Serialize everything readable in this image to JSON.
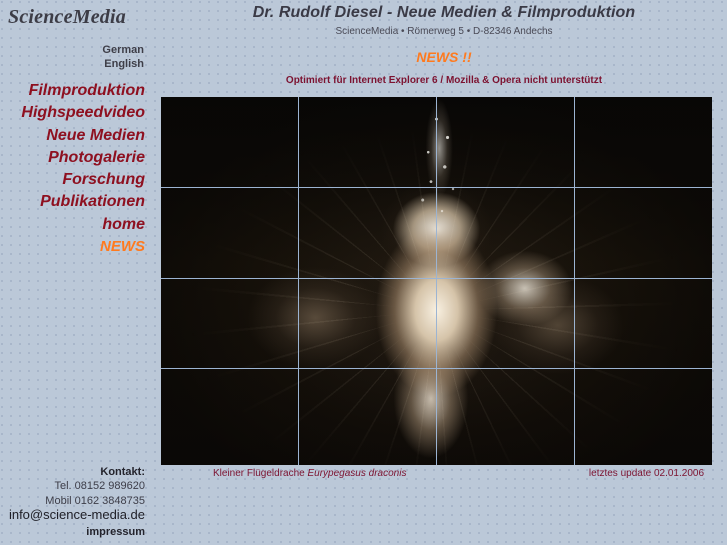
{
  "brand": {
    "logo": "ScienceMedia"
  },
  "language_nav": {
    "items": [
      {
        "label": "German"
      },
      {
        "label": "English"
      }
    ]
  },
  "main_nav": {
    "items": [
      {
        "label": "Filmproduktion"
      },
      {
        "label": "Highspeedvideo"
      },
      {
        "label": "Neue Medien"
      },
      {
        "label": "Photogalerie"
      },
      {
        "label": "Forschung"
      },
      {
        "label": "Publikationen"
      },
      {
        "label": "home"
      },
      {
        "label": "NEWS"
      }
    ],
    "link_color": "#8e1020",
    "news_color": "#ff7a1e"
  },
  "contact": {
    "heading": "Kontakt:",
    "phone": "Tel. 08152 989620",
    "mobile": "Mobil 0162 3848735",
    "email": "info@science-media.de",
    "impressum": "impressum"
  },
  "header": {
    "title": "Dr. Rudolf Diesel  -  Neue Medien & Filmproduktion",
    "subtitle": "ScienceMedia • Römerweg 5 • D-82346 Andechs",
    "news_banner": "NEWS !!",
    "browser_notice": "Optimiert für Internet Explorer 6 / Mozilla & Opera nicht unterstützt",
    "news_color": "#ff7a1e",
    "notice_color": "#7c1230"
  },
  "feature_image": {
    "alt": "Kleiner Flügeldrache Eurypegasus draconis underwater photograph",
    "grid_line_color": "#9cb4d2"
  },
  "caption": {
    "common_name": "Kleiner Flügeldrache ",
    "species_name": "Eurypegasus draconis",
    "last_update": "letztes update 02.01.2006"
  }
}
